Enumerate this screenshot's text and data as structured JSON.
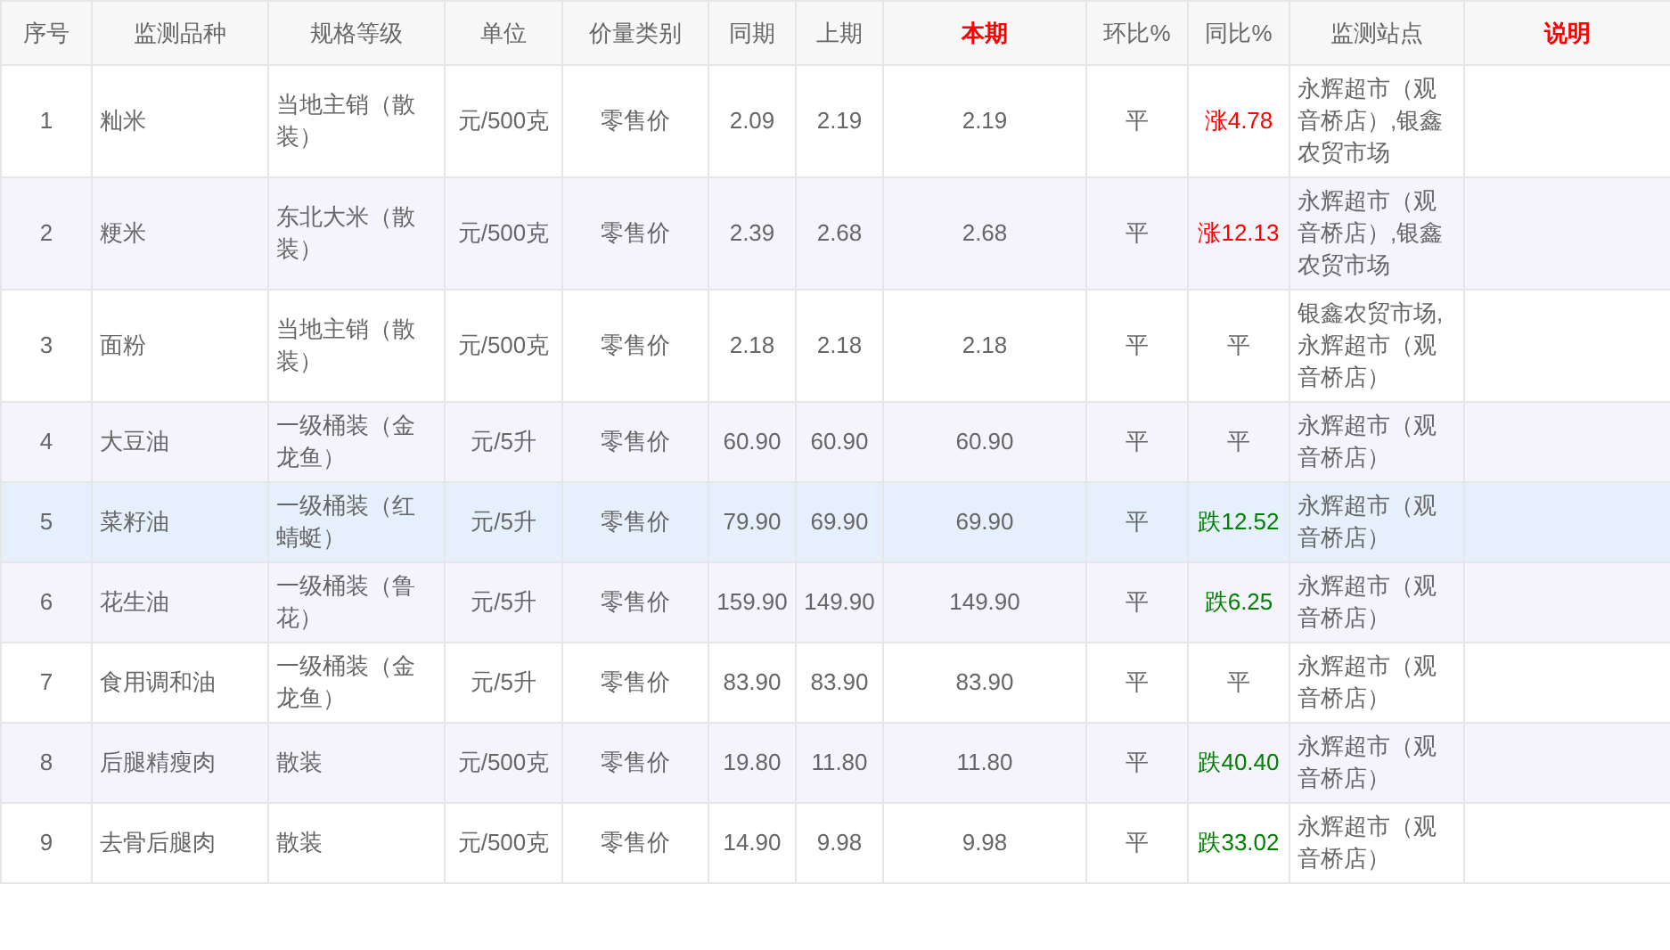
{
  "table": {
    "columns": [
      {
        "label": "序号",
        "emphasis": false
      },
      {
        "label": "监测品种",
        "emphasis": false
      },
      {
        "label": "规格等级",
        "emphasis": false
      },
      {
        "label": "单位",
        "emphasis": false
      },
      {
        "label": "价量类别",
        "emphasis": false
      },
      {
        "label": "同期",
        "emphasis": false
      },
      {
        "label": "上期",
        "emphasis": false
      },
      {
        "label": "本期",
        "emphasis": true
      },
      {
        "label": "环比%",
        "emphasis": false
      },
      {
        "label": "同比%",
        "emphasis": false
      },
      {
        "label": "监测站点",
        "emphasis": false
      },
      {
        "label": "说明",
        "emphasis": true
      }
    ],
    "rows": [
      {
        "hovered": false,
        "no": "1",
        "item": "籼米",
        "spec": "当地主销（散装）",
        "unit": "元/500克",
        "price_type": "零售价",
        "same_period": "2.09",
        "last_period": "2.19",
        "current": "2.19",
        "mom": "平",
        "yoy": {
          "text": "涨4.78",
          "color": "#ff0000"
        },
        "stations": "永辉超市（观音桥店）,银鑫农贸市场"
      },
      {
        "hovered": false,
        "no": "2",
        "item": "粳米",
        "spec": "东北大米（散装）",
        "unit": "元/500克",
        "price_type": "零售价",
        "same_period": "2.39",
        "last_period": "2.68",
        "current": "2.68",
        "mom": "平",
        "yoy": {
          "text": "涨12.13",
          "color": "#ff0000"
        },
        "stations": "永辉超市（观音桥店）,银鑫农贸市场"
      },
      {
        "hovered": false,
        "no": "3",
        "item": "面粉",
        "spec": "当地主销（散装）",
        "unit": "元/500克",
        "price_type": "零售价",
        "same_period": "2.18",
        "last_period": "2.18",
        "current": "2.18",
        "mom": "平",
        "yoy": {
          "text": "平",
          "color": "#666666"
        },
        "stations": "银鑫农贸市场,永辉超市（观音桥店）"
      },
      {
        "hovered": false,
        "no": "4",
        "item": "大豆油",
        "spec": "一级桶装（金龙鱼）",
        "unit": "元/5升",
        "price_type": "零售价",
        "same_period": "60.90",
        "last_period": "60.90",
        "current": "60.90",
        "mom": "平",
        "yoy": {
          "text": "平",
          "color": "#666666"
        },
        "stations": "永辉超市（观音桥店）"
      },
      {
        "hovered": true,
        "no": "5",
        "item": "菜籽油",
        "spec": "一级桶装（红蜻蜓）",
        "unit": "元/5升",
        "price_type": "零售价",
        "same_period": "79.90",
        "last_period": "69.90",
        "current": "69.90",
        "mom": "平",
        "yoy": {
          "text": "跌12.52",
          "color": "#008000"
        },
        "stations": "永辉超市（观音桥店）"
      },
      {
        "hovered": false,
        "no": "6",
        "item": "花生油",
        "spec": "一级桶装（鲁花）",
        "unit": "元/5升",
        "price_type": "零售价",
        "same_period": "159.90",
        "last_period": "149.90",
        "current": "149.90",
        "mom": "平",
        "yoy": {
          "text": "跌6.25",
          "color": "#008000"
        },
        "stations": "永辉超市（观音桥店）"
      },
      {
        "hovered": false,
        "no": "7",
        "item": "食用调和油",
        "spec": "一级桶装（金龙鱼）",
        "unit": "元/5升",
        "price_type": "零售价",
        "same_period": "83.90",
        "last_period": "83.90",
        "current": "83.90",
        "mom": "平",
        "yoy": {
          "text": "平",
          "color": "#666666"
        },
        "stations": "永辉超市（观音桥店）"
      },
      {
        "hovered": false,
        "no": "8",
        "item": "后腿精瘦肉",
        "spec": "散装",
        "unit": "元/500克",
        "price_type": "零售价",
        "same_period": "19.80",
        "last_period": "11.80",
        "current": "11.80",
        "mom": "平",
        "yoy": {
          "text": "跌40.40",
          "color": "#008000"
        },
        "stations": "永辉超市（观音桥店）"
      },
      {
        "hovered": false,
        "no": "9",
        "item": "去骨后腿肉",
        "spec": "散装",
        "unit": "元/500克",
        "price_type": "零售价",
        "same_period": "14.90",
        "last_period": "9.98",
        "current": "9.98",
        "mom": "平",
        "yoy": {
          "text": "跌33.02",
          "color": "#008000"
        },
        "stations": "永辉超市（观音桥店）"
      }
    ]
  }
}
